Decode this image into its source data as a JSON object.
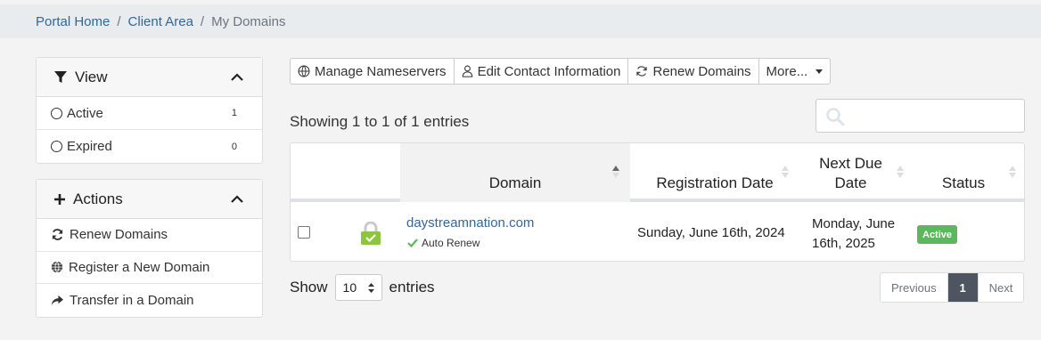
{
  "breadcrumb": {
    "items": [
      "Portal Home",
      "Client Area"
    ],
    "separator": "/",
    "current": "My Domains"
  },
  "view_panel": {
    "title": "View",
    "filters": [
      {
        "label": "Active",
        "count": "1"
      },
      {
        "label": "Expired",
        "count": "0"
      }
    ]
  },
  "actions_panel": {
    "title": "Actions",
    "items": [
      {
        "label": "Renew Domains",
        "icon": "refresh-icon"
      },
      {
        "label": "Register a New Domain",
        "icon": "globe-icon"
      },
      {
        "label": "Transfer in a Domain",
        "icon": "share-arrow-icon"
      }
    ]
  },
  "toolbar": {
    "manage_nameservers": "Manage Nameservers",
    "edit_contact": "Edit Contact Information",
    "renew_domains": "Renew Domains",
    "more": "More..."
  },
  "table_info": "Showing 1 to 1 of 1 entries",
  "table": {
    "headers": [
      "Domain",
      "Registration Date",
      "Next Due Date",
      "Status"
    ],
    "rows": [
      {
        "domain": "daystreamnation.com",
        "auto_renew": "Auto Renew",
        "registration_date": "Sunday, June 16th, 2024",
        "next_due_date": "Monday, June 16th, 2025",
        "status": "Active"
      }
    ]
  },
  "length_menu": {
    "prefix": "Show",
    "value": "10",
    "suffix": "entries"
  },
  "pagination": {
    "previous": "Previous",
    "current": "1",
    "next": "Next"
  },
  "colors": {
    "link": "#336699",
    "status_active": "#5cb85c",
    "page_active": "#4e5561",
    "lock": "#8cc63f"
  }
}
